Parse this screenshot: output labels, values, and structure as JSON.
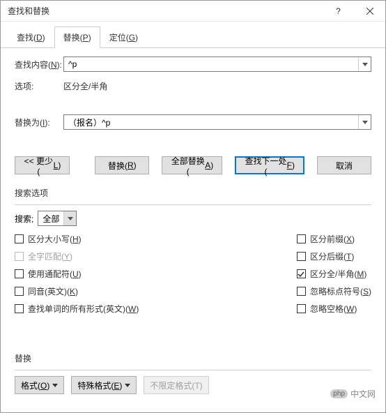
{
  "window": {
    "title": "查找和替换"
  },
  "tabs": {
    "find": "查找(D)",
    "replace": "替换(P)",
    "goto": "定位(G)"
  },
  "form": {
    "find_label": "查找内容(N):",
    "find_value": "^p",
    "options_label": "选项:",
    "options_value": "区分全/半角",
    "replace_label": "替换为(I):",
    "replace_value": "（报名）^p"
  },
  "buttons": {
    "less": "<< 更少(L)",
    "replace": "替换(R)",
    "replace_all": "全部替换(A)",
    "find_next": "查找下一处(F)",
    "cancel": "取消"
  },
  "search_options": {
    "group_label": "搜索选项",
    "search_label": "搜索;",
    "search_value": "全部",
    "match_case": "区分大小写(H)",
    "whole_word": "全字匹配(Y)",
    "wildcards": "使用通配符(U)",
    "sounds_like": "同音(英文)(K)",
    "word_forms": "查找单词的所有形式(英文)(W)",
    "prefix": "区分前缀(X)",
    "suffix": "区分后缀(T)",
    "full_half": "区分全/半角(M)",
    "ignore_punct": "忽略标点符号(S)",
    "ignore_space": "忽略空格(W)"
  },
  "bottom": {
    "label": "替换",
    "format": "格式(O)",
    "special": "特殊格式(E)",
    "no_format": "不限定格式(T)"
  },
  "watermark": {
    "logo": "php",
    "text": "中文网"
  }
}
